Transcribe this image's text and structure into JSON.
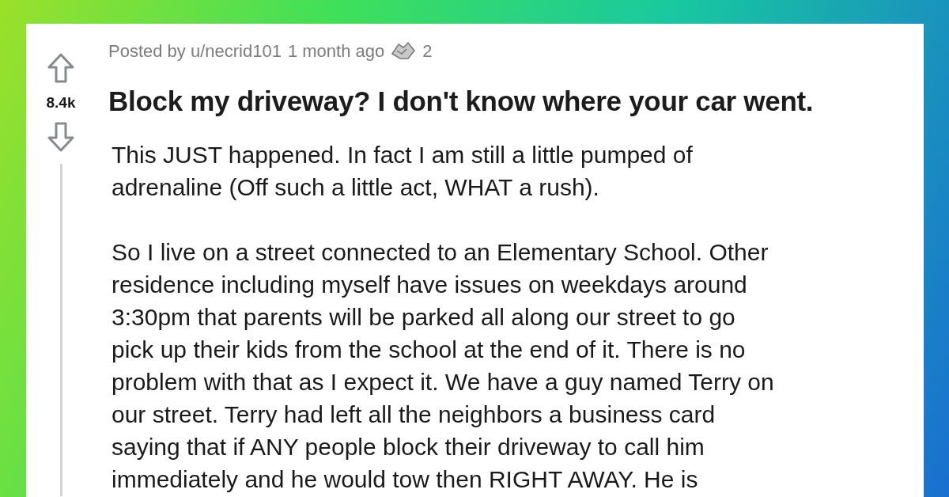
{
  "post": {
    "meta": {
      "posted_by": "Posted by u/necrid101",
      "age": "1 month ago",
      "award_count": "2"
    },
    "score": "8.4k",
    "title": "Block my driveway? I don't know where your car went.",
    "paragraphs": [
      {
        "lines": [
          "This JUST happened. In fact I am still a little pumped of",
          "adrenaline (Off such a little act, WHAT a rush)."
        ]
      },
      {
        "lines": [
          "So I live on a street connected to an Elementary School. Other",
          "residence including myself have issues on weekdays around",
          "3:30pm that parents will be parked all along our street to go",
          "pick up their kids from the school at the end of it. There is no",
          "problem with that as I expect it. We have a guy named Terry on",
          "our street. Terry had left all the neighbors a business card",
          "saying that if ANY people block their driveway to call him",
          "immediately and he would tow then RIGHT AWAY. He is"
        ]
      }
    ]
  }
}
